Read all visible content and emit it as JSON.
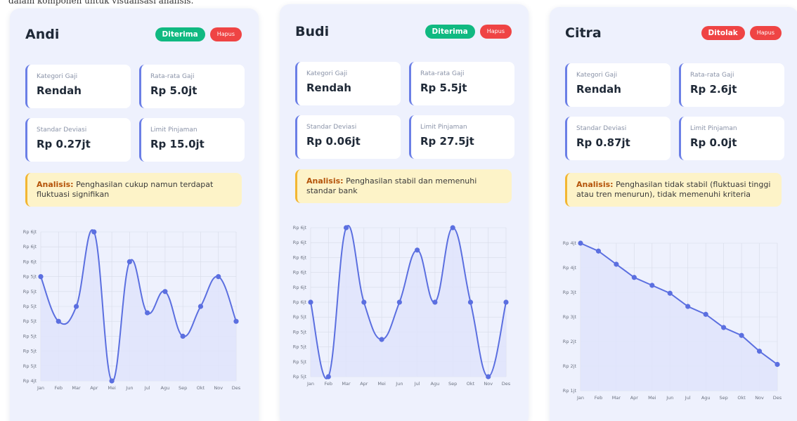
{
  "page": {
    "top_text": "dalam komponen untuk visualisasi analisis."
  },
  "cards": [
    {
      "name": "Andi",
      "status_label": "Diterima",
      "status": "ok",
      "delete_label": "Hapus",
      "stats": [
        {
          "label": "Kategori Gaji",
          "value": "Rendah"
        },
        {
          "label": "Rata-rata Gaji",
          "value": "Rp 5.0jt"
        },
        {
          "label": "Standar Deviasi",
          "value": "Rp 0.27jt"
        },
        {
          "label": "Limit Pinjaman",
          "value": "Rp 15.0jt"
        }
      ],
      "analysis_prefix": "Analisis:",
      "analysis_text": "Penghasilan cukup namun terdapat fluktuasi signifikan"
    },
    {
      "name": "Budi",
      "status_label": "Diterima",
      "status": "ok",
      "delete_label": "Hapus",
      "stats": [
        {
          "label": "Kategori Gaji",
          "value": "Rendah"
        },
        {
          "label": "Rata-rata Gaji",
          "value": "Rp 5.5jt"
        },
        {
          "label": "Standar Deviasi",
          "value": "Rp 0.06jt"
        },
        {
          "label": "Limit Pinjaman",
          "value": "Rp 27.5jt"
        }
      ],
      "analysis_prefix": "Analisis:",
      "analysis_text": "Penghasilan stabil dan memenuhi standar bank"
    },
    {
      "name": "Citra",
      "status_label": "Ditolak",
      "status": "bad",
      "delete_label": "Hapus",
      "stats": [
        {
          "label": "Kategori Gaji",
          "value": "Rendah"
        },
        {
          "label": "Rata-rata Gaji",
          "value": "Rp 2.6jt"
        },
        {
          "label": "Standar Deviasi",
          "value": "Rp 0.87jt"
        },
        {
          "label": "Limit Pinjaman",
          "value": "Rp 0.0jt"
        }
      ],
      "analysis_prefix": "Analisis:",
      "analysis_text": "Penghasilan tidak stabil (fluktuasi tinggi atau tren menurun), tidak memenuhi kriteria"
    }
  ],
  "colors": {
    "line": "#5b6fe0",
    "fill": "#dfe4fb",
    "grid": "#d7dbe8",
    "approved": "#10b981",
    "rejected": "#ef4444"
  },
  "chart_data": [
    {
      "type": "area",
      "categories": [
        "Jan",
        "Feb",
        "Mar",
        "Apr",
        "Mei",
        "Jun",
        "Jul",
        "Agu",
        "Sep",
        "Okt",
        "Nov",
        "Des"
      ],
      "y_ticks": [
        "Rp 6jt",
        "Rp 6jt",
        "Rp 6jt",
        "Rp 5jt",
        "Rp 5jt",
        "Rp 5jt",
        "Rp 5jt",
        "Rp 5jt",
        "Rp 5jt",
        "Rp 5jt",
        "Rp 4jt"
      ],
      "ylim": [
        4.65,
        5.35
      ],
      "values": [
        5.14,
        4.93,
        5.0,
        5.35,
        4.65,
        5.21,
        4.97,
        5.07,
        4.86,
        5.0,
        5.14,
        4.93
      ],
      "smooth": true,
      "grid": true
    },
    {
      "type": "area",
      "categories": [
        "Jan",
        "Feb",
        "Mar",
        "Apr",
        "Mei",
        "Jun",
        "Jul",
        "Agu",
        "Sep",
        "Okt",
        "Nov",
        "Des"
      ],
      "y_ticks": [
        "Rp 6jt",
        "Rp 6jt",
        "Rp 6jt",
        "Rp 6jt",
        "Rp 6jt",
        "Rp 6jt",
        "Rp 5jt",
        "Rp 5jt",
        "Rp 5jt",
        "Rp 5jt",
        "Rp 5jt"
      ],
      "ylim": [
        5.4,
        5.6
      ],
      "values": [
        5.5,
        5.4,
        5.6,
        5.5,
        5.45,
        5.5,
        5.57,
        5.5,
        5.6,
        5.5,
        5.4,
        5.5
      ],
      "smooth": true,
      "grid": true
    },
    {
      "type": "area",
      "categories": [
        "Jan",
        "Feb",
        "Mar",
        "Apr",
        "Mei",
        "Jun",
        "Jul",
        "Agu",
        "Sep",
        "Okt",
        "Nov",
        "Des"
      ],
      "y_ticks": [
        "Rp 4jt",
        "Rp 4jt",
        "Rp 3jt",
        "Rp 3jt",
        "Rp 2jt",
        "Rp 2jt",
        "Rp 1jt"
      ],
      "ylim": [
        1.2,
        4.0
      ],
      "values": [
        4.0,
        3.85,
        3.6,
        3.35,
        3.2,
        3.05,
        2.8,
        2.65,
        2.4,
        2.25,
        1.95,
        1.7
      ],
      "smooth": false,
      "grid": true
    }
  ]
}
